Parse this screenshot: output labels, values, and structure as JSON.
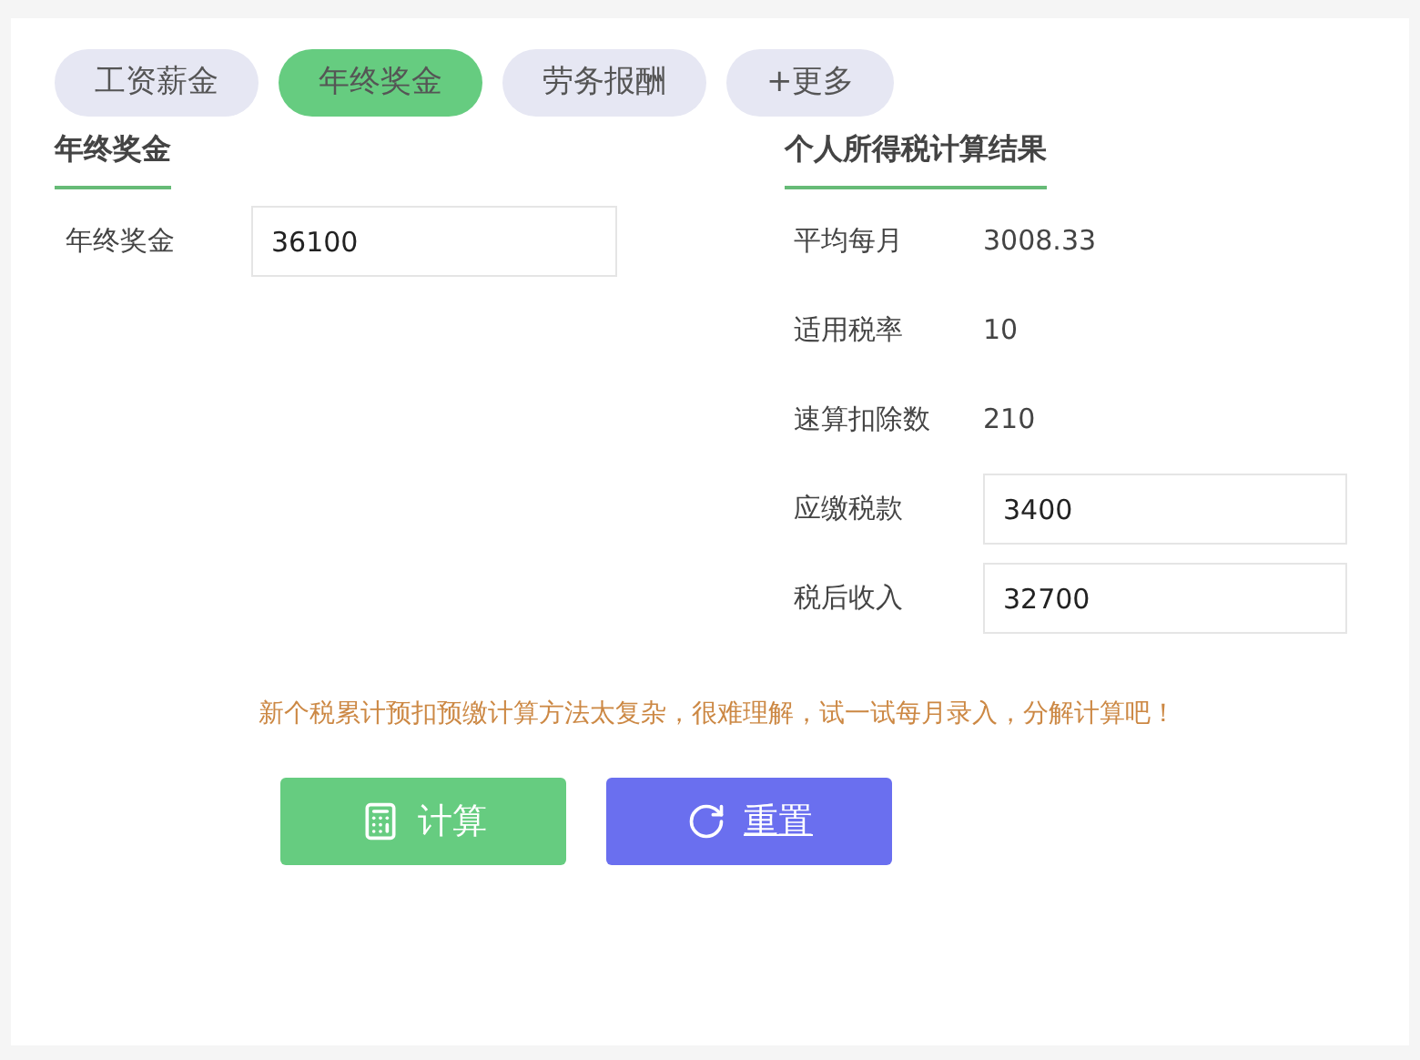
{
  "tabs": [
    {
      "label": "工资薪金",
      "selected": false
    },
    {
      "label": "年终奖金",
      "selected": true
    },
    {
      "label": "劳务报酬",
      "selected": false
    },
    {
      "label": "+更多",
      "selected": false
    }
  ],
  "input_section": {
    "title": "年终奖金",
    "fields": [
      {
        "label": "年终奖金",
        "value": "36100"
      }
    ]
  },
  "result_section": {
    "title": "个人所得税计算结果",
    "rows": [
      {
        "kind": "text",
        "label": "平均每月",
        "value": "3008.33"
      },
      {
        "kind": "text",
        "label": "适用税率",
        "value": "10"
      },
      {
        "kind": "text",
        "label": "速算扣除数",
        "value": "210"
      },
      {
        "kind": "field",
        "label": "应缴税款",
        "value": "3400"
      },
      {
        "kind": "field",
        "label": "税后收入",
        "value": "32700"
      }
    ]
  },
  "note": "新个税累计预扣预缴计算方法太复杂，很难理解，试一试每月录入，分解计算吧！",
  "buttons": [
    {
      "kind": "calculate",
      "label": "计算"
    },
    {
      "kind": "reset",
      "label": "重置"
    }
  ]
}
